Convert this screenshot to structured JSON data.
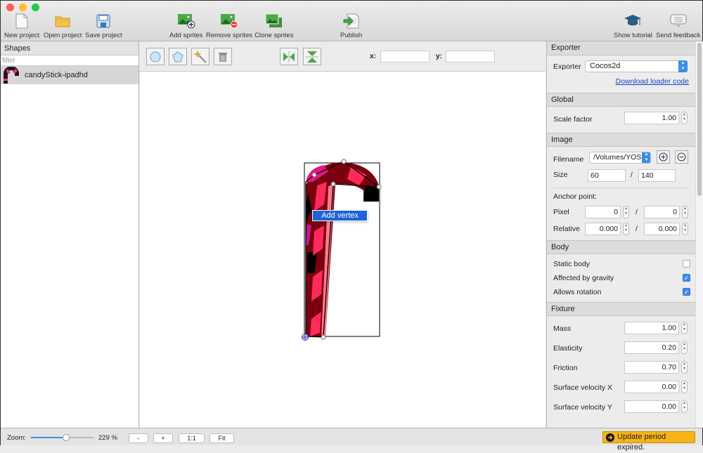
{
  "toolbar": {
    "new_project": "New project",
    "open_project": "Open project",
    "save_project": "Save project",
    "add_sprites": "Add sprites",
    "remove_sprites": "Remove sprites",
    "clone_sprites": "Clone sprites",
    "publish": "Publish",
    "show_tutorial": "Show tutorial",
    "send_feedback": "Send feedback"
  },
  "shapes": {
    "title": "Shapes",
    "filter_placeholder": "filter",
    "items": [
      {
        "label": "candyStick-ipadhd"
      }
    ]
  },
  "canvas": {
    "x_label": "x:",
    "y_label": "y:",
    "x_value": "",
    "y_value": "",
    "context_menu": "Add vertex"
  },
  "exporter": {
    "title": "Exporter",
    "label": "Exporter",
    "value": "Cocos2d",
    "link": "Download loader code"
  },
  "global": {
    "title": "Global",
    "scale_label": "Scale factor",
    "scale_value": "1.00"
  },
  "image": {
    "title": "Image",
    "filename_label": "Filename",
    "filename_value": "/Volumes/YOS",
    "size_label": "Size",
    "width": "60",
    "height": "140",
    "slash": "/",
    "anchor_label": "Anchor point:",
    "pixel_label": "Pixel",
    "pixel_x": "0",
    "pixel_y": "0",
    "relative_label": "Relative",
    "relative_x": "0.000",
    "relative_y": "0.000"
  },
  "body": {
    "title": "Body",
    "static_label": "Static body",
    "static_checked": false,
    "gravity_label": "Affected by gravity",
    "gravity_checked": true,
    "rotation_label": "Allows rotation",
    "rotation_checked": true
  },
  "fixture": {
    "title": "Fixture",
    "fields": [
      {
        "label": "Mass",
        "value": "1.00"
      },
      {
        "label": "Elasticity",
        "value": "0.20"
      },
      {
        "label": "Friction",
        "value": "0.70"
      },
      {
        "label": "Surface velocity X",
        "value": "0.00"
      },
      {
        "label": "Surface velocity Y",
        "value": "0.00"
      }
    ]
  },
  "status": {
    "zoom_label": "Zoom:",
    "zoom_value": "229 %",
    "zoom_fraction": 0.55,
    "minus": "-",
    "plus": "+",
    "one_to_one": "1:1",
    "fit": "Fit",
    "update_notice": "Update period expired."
  },
  "colors": {
    "accent": "#2f6fd6",
    "link": "#1a3fc9",
    "update_badge": "#f7b417",
    "candy_dark": "#7a0010",
    "candy_pink": "#ff2a5a"
  }
}
